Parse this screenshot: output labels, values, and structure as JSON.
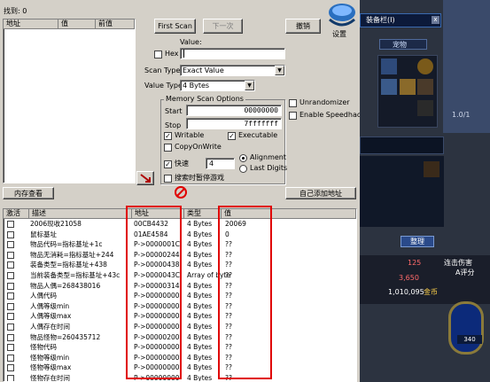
{
  "window": {
    "found_label": "找到: 0",
    "logo_caption": "设置"
  },
  "result_list": {
    "columns": [
      "地址",
      "值",
      "前值"
    ]
  },
  "scan": {
    "first_scan": "First Scan",
    "next_scan": "下一次",
    "undo_scan": "撤销",
    "value_label": "Value:",
    "hex_label": "Hex",
    "value_input": "",
    "scan_type_label": "Scan Type",
    "scan_type_value": "Exact Value",
    "value_type_label": "Value Type",
    "value_type_value": "4 Bytes",
    "memory_options_title": "Memory Scan Options",
    "start_label": "Start",
    "start_value": "00000000",
    "stop_label": "Stop",
    "stop_value": "7fffffff",
    "writable_label": "Writable",
    "executable_label": "Executable",
    "copyonwrite_label": "CopyOnWrite",
    "fast_label": "快速",
    "fast_value": "4",
    "alignment_label": "Alignment",
    "lastdigits_label": "Last Digits",
    "pause_label": "搜索时暂停游戏",
    "unrandomizer_label": "Unrandomizer",
    "speedhack_label": "Enable Speedhack"
  },
  "toolbar": {
    "memory_view": "内存查看",
    "add_address": "自己添加地址"
  },
  "address_table": {
    "columns": [
      "激活",
      "描述",
      "地址",
      "类型",
      "值"
    ],
    "rows": [
      {
        "desc": "2006现收21058",
        "addr": "00CB4432",
        "type": "4 Bytes",
        "value": "20069"
      },
      {
        "desc": "鼠标基址",
        "addr": "01AE4584",
        "type": "4 Bytes",
        "value": "0"
      },
      {
        "desc": "物品代码=指标基址+1c",
        "addr": "P->0000001C",
        "type": "4 Bytes",
        "value": "??"
      },
      {
        "desc": "物品无消耗=指标基址+244",
        "addr": "P->00000244",
        "type": "4 Bytes",
        "value": "??"
      },
      {
        "desc": "装备类型=指标基址+438",
        "addr": "P->00000438",
        "type": "4 Bytes",
        "value": "??"
      },
      {
        "desc": "当前装备类型=指标基址+43c",
        "addr": "P->0000043C",
        "type": "Array of byte",
        "value": "??"
      },
      {
        "desc": "物品人偶=268438016",
        "addr": "P->00000314",
        "type": "4 Bytes",
        "value": "??"
      },
      {
        "desc": "人偶代码",
        "addr": "P->00000000",
        "type": "4 Bytes",
        "value": "??"
      },
      {
        "desc": "人偶等级min",
        "addr": "P->00000000",
        "type": "4 Bytes",
        "value": "??"
      },
      {
        "desc": "人偶等级max",
        "addr": "P->00000000",
        "type": "4 Bytes",
        "value": "??"
      },
      {
        "desc": "人偶存在时间",
        "addr": "P->00000000",
        "type": "4 Bytes",
        "value": "??"
      },
      {
        "desc": "物品怪物=260435712",
        "addr": "P->00000200",
        "type": "4 Bytes",
        "value": "??"
      },
      {
        "desc": "怪物代码",
        "addr": "P->00000000",
        "type": "4 Bytes",
        "value": "??"
      },
      {
        "desc": "怪物等级min",
        "addr": "P->00000000",
        "type": "4 Bytes",
        "value": "??"
      },
      {
        "desc": "怪物等级max",
        "addr": "P->00000000",
        "type": "4 Bytes",
        "value": "??"
      },
      {
        "desc": "怪物存在时间",
        "addr": "P->00000000",
        "type": "4 Bytes",
        "value": "??"
      }
    ]
  },
  "game": {
    "title": "装备栏(I)",
    "tab": "宠物",
    "level_text": "1.0/1",
    "numbers": [
      "125",
      "3,650",
      "1,010,095"
    ],
    "coin_label": "金币",
    "button": "整理",
    "attack_text": "连击伤害",
    "rating_text": "A评分",
    "hp": "340",
    "colors": {
      "accent": "#e00000",
      "panel": "#2c3340"
    }
  }
}
